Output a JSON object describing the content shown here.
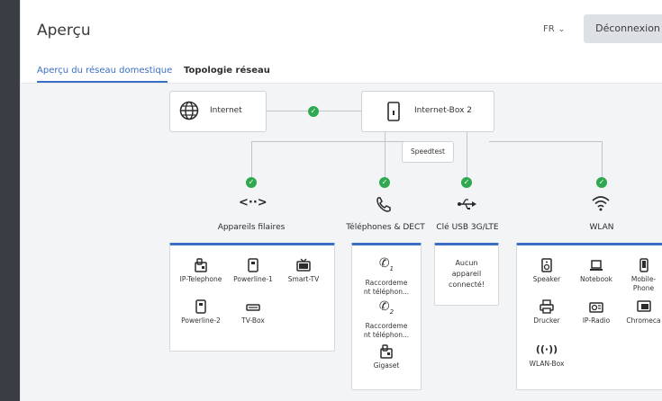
{
  "header": {
    "title": "Aperçu",
    "language": "FR",
    "logout_label": "Déconnexion"
  },
  "tabs": [
    {
      "label": "Aperçu du réseau domestique"
    },
    {
      "label": "Topologie réseau"
    }
  ],
  "topology": {
    "internet_label": "Internet",
    "box_label": "Internet-Box 2",
    "speedtest_label": "Speedtest",
    "categories": [
      {
        "label": "Appareils filaires"
      },
      {
        "label": "Téléphones & DECT"
      },
      {
        "label": "Clé USB 3G/LTE"
      },
      {
        "label": "WLAN"
      }
    ],
    "wired_devices": [
      "IP-Telephone",
      "Powerline-1",
      "Smart-TV",
      "Powerline-2",
      "TV-Box"
    ],
    "phone_devices": [
      "Raccordement téléphon...",
      "Raccordement téléphon...",
      "Gigaset"
    ],
    "phone_device_lines": [
      [
        "Raccordeme",
        "nt téléphon..."
      ],
      [
        "Raccordeme",
        "nt téléphon..."
      ]
    ],
    "usb_panel_lines": [
      "Aucun",
      "appareil",
      "connecté!"
    ],
    "wlan_devices": [
      "Speaker",
      "Notebook",
      "Mobile-",
      "Phone",
      "Drucker",
      "IP-Radio",
      "Chromeca",
      "WLAN-Box"
    ]
  },
  "colors": {
    "accent": "#3a6fc4",
    "status_ok": "#2fa84f"
  }
}
